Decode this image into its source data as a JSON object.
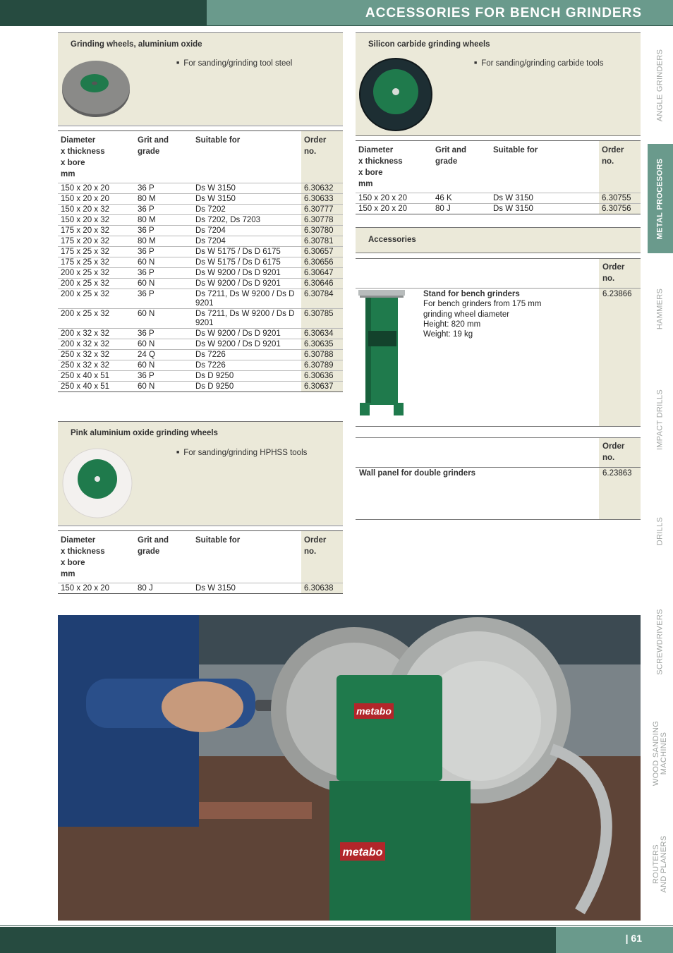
{
  "header": {
    "title": "ACCESSORIES FOR BENCH GRINDERS"
  },
  "sidebar": {
    "tabs": [
      {
        "label": "ANGLE GRINDERS",
        "active": false
      },
      {
        "label": "METAL PROCESORS",
        "active": true
      },
      {
        "label": "HAMMERS",
        "active": false
      },
      {
        "label": "IMPACT DRILLS",
        "active": false
      },
      {
        "label": "DRILLS",
        "active": false
      },
      {
        "label": "SCREWDRIVERS",
        "active": false
      },
      {
        "label_line1": "WOOD SANDING",
        "label_line2": "MACHINES",
        "active": false
      },
      {
        "label_line1": "ROUTERS",
        "label_line2": "AND PLANERS",
        "active": false
      }
    ]
  },
  "colors": {
    "dark_green": "#264b40",
    "light_green": "#6a9a8c",
    "panel_beige": "#ebe9d9",
    "wheel_green": "#1f7a4c"
  },
  "section_aluminium": {
    "title": "Grinding wheels, aluminium oxide",
    "bullet": "For sanding/grinding tool steel",
    "headers": {
      "diameter": "Diameter x thickness x bore mm",
      "grit": "Grit and grade",
      "suitable": "Suitable for",
      "order": "Order no."
    },
    "rows": [
      {
        "dim": "150 x 20 x 20",
        "grit": "36 P",
        "suit": "Ds W 3150",
        "order": "6.30632"
      },
      {
        "dim": "150 x 20 x 20",
        "grit": "80 M",
        "suit": "Ds W 3150",
        "order": "6.30633"
      },
      {
        "dim": "150 x 20 x 32",
        "grit": "36 P",
        "suit": "Ds 7202",
        "order": "6.30777"
      },
      {
        "dim": "150 x 20 x 32",
        "grit": "80 M",
        "suit": "Ds 7202, Ds 7203",
        "order": "6.30778"
      },
      {
        "dim": "175 x 20 x 32",
        "grit": "36 P",
        "suit": "Ds 7204",
        "order": "6.30780"
      },
      {
        "dim": "175 x 20 x 32",
        "grit": "80 M",
        "suit": "Ds 7204",
        "order": "6.30781"
      },
      {
        "dim": "175 x 25 x 32",
        "grit": "36 P",
        "suit": "Ds W 5175 / Ds D 6175",
        "order": "6.30657"
      },
      {
        "dim": "175 x 25 x 32",
        "grit": "60 N",
        "suit": "Ds W 5175 / Ds D 6175",
        "order": "6.30656"
      },
      {
        "dim": "200 x 25 x 32",
        "grit": "36 P",
        "suit": "Ds W 9200 / Ds D 9201",
        "order": "6.30647"
      },
      {
        "dim": "200 x 25 x 32",
        "grit": "60 N",
        "suit": "Ds W 9200 / Ds D 9201",
        "order": "6.30646"
      },
      {
        "dim": "200 x 25 x 32",
        "grit": "36 P",
        "suit": "Ds 7211, Ds W 9200 / Ds D 9201",
        "order": "6.30784"
      },
      {
        "dim": "200 x 25 x 32",
        "grit": "60 N",
        "suit": "Ds 7211, Ds W 9200 / Ds D 9201",
        "order": "6.30785"
      },
      {
        "dim": "200 x 32 x 32",
        "grit": "36 P",
        "suit": "Ds W 9200 / Ds D 9201",
        "order": "6.30634"
      },
      {
        "dim": "200 x 32 x 32",
        "grit": "60 N",
        "suit": "Ds W 9200 / Ds D 9201",
        "order": "6.30635"
      },
      {
        "dim": "250 x 32 x 32",
        "grit": "24 Q",
        "suit": "Ds 7226",
        "order": "6.30788"
      },
      {
        "dim": "250 x 32 x 32",
        "grit": "60 N",
        "suit": "Ds 7226",
        "order": "6.30789"
      },
      {
        "dim": "250 x 40 x 51",
        "grit": "36 P",
        "suit": "Ds D 9250",
        "order": "6.30636"
      },
      {
        "dim": "250 x 40 x 51",
        "grit": "60 N",
        "suit": "Ds D 9250",
        "order": "6.30637"
      }
    ]
  },
  "section_pink": {
    "title": "Pink aluminium oxide grinding wheels",
    "bullet": "For sanding/grinding HPHSS tools",
    "rows": [
      {
        "dim": "150 x 20 x 20",
        "grit": "80 J",
        "suit": "Ds W 3150",
        "order": "6.30638"
      }
    ]
  },
  "section_silicon": {
    "title": "Silicon carbide grinding wheels",
    "bullet": "For sanding/grinding carbide tools",
    "rows": [
      {
        "dim": "150 x 20 x 20",
        "grit": "46 K",
        "suit": "Ds W 3150",
        "order": "6.30755"
      },
      {
        "dim": "150 x 20 x 20",
        "grit": "80 J",
        "suit": "Ds W 3150",
        "order": "6.30756"
      }
    ]
  },
  "section_accessories": {
    "title": "Accessories",
    "order_header": "Order no.",
    "stand": {
      "name": "Stand for bench grinders",
      "desc1": "For bench grinders from 175 mm",
      "desc2": "grinding wheel diameter",
      "height": "Height: 820 mm",
      "weight": "Weight: 19 kg",
      "order": "6.23866"
    },
    "wall_panel": {
      "name": "Wall panel for double grinders",
      "order": "6.23863"
    }
  },
  "wheel_brand": "metabo",
  "footer": {
    "page": "| 61"
  }
}
